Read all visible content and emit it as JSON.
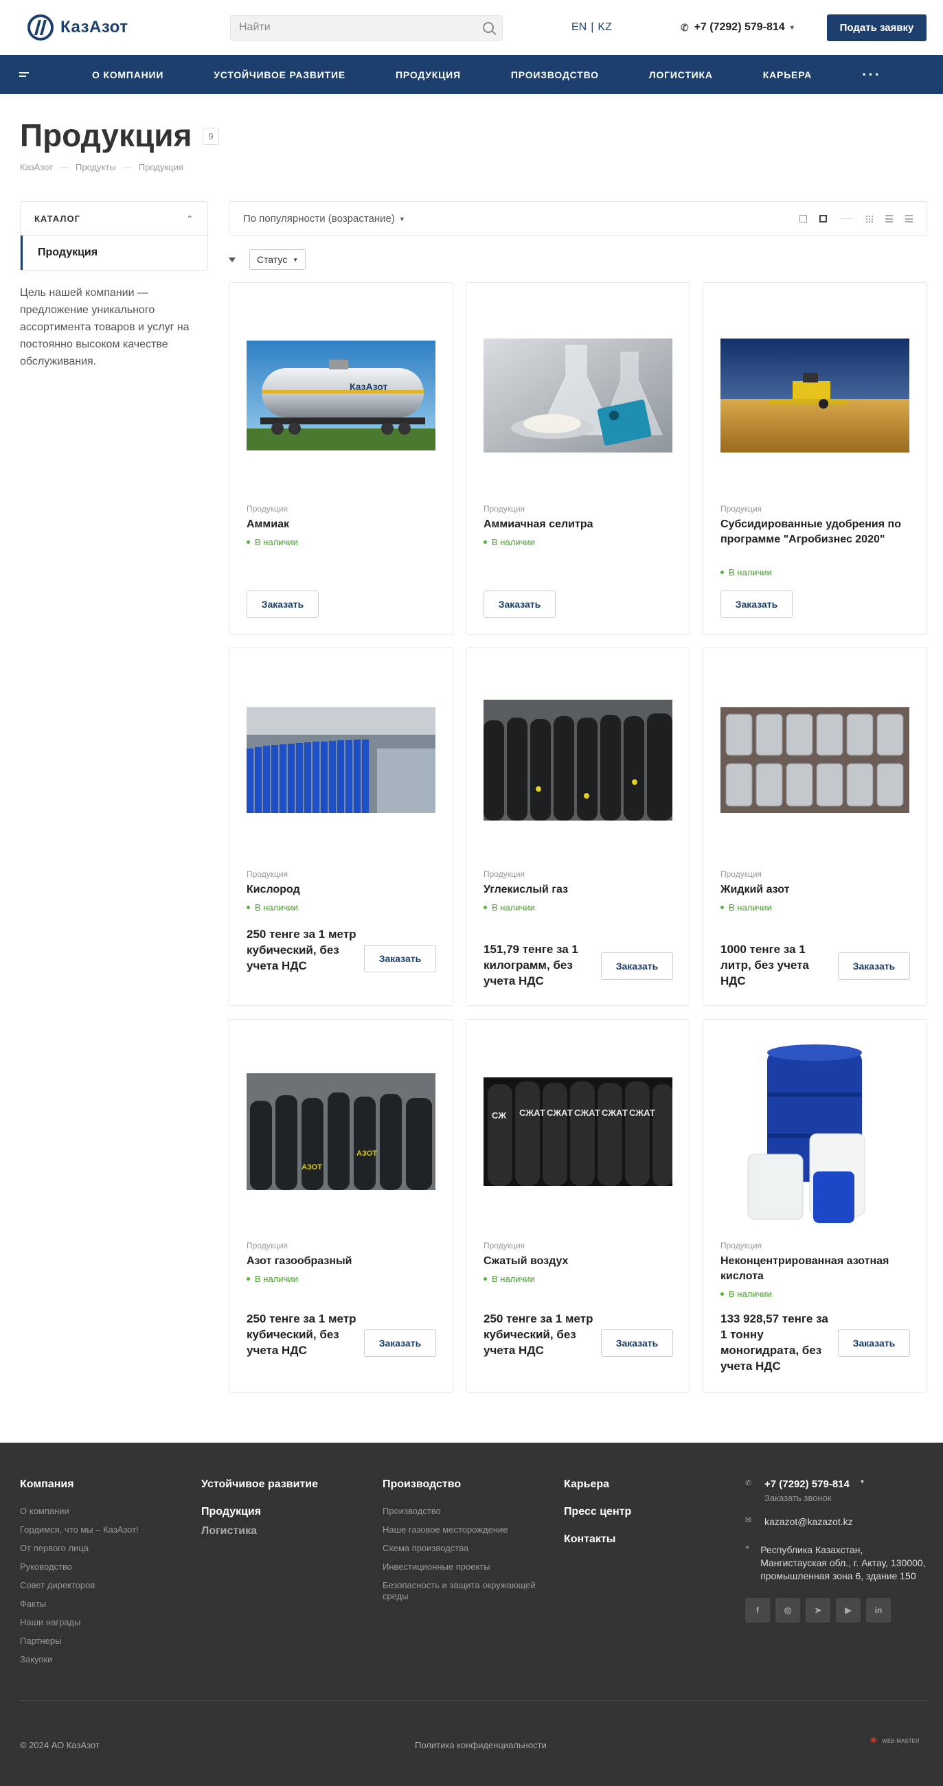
{
  "header": {
    "logo_text": "КазАзот",
    "search_placeholder": "Найти",
    "lang_en": "EN",
    "lang_sep": "|",
    "lang_kz": "KZ",
    "phone": "+7 (7292) 579-814",
    "apply_button": "Подать заявку"
  },
  "nav": {
    "items": [
      "О компании",
      "Устойчивое развитие",
      "Продукция",
      "Производство",
      "Логистика",
      "Карьера"
    ],
    "more": "···"
  },
  "page": {
    "title": "Продукция",
    "count": "9",
    "breadcrumb": [
      "КазАзот",
      "Продукты",
      "Продукция"
    ]
  },
  "sidebar": {
    "catalog_label": "КАТАЛОГ",
    "active_item": "Продукция",
    "description": "Цель нашей компании — предложение уникального ассортимента товаров и услуг на постоянно высоком качестве обслуживания."
  },
  "toolbar": {
    "sort_label": "По популярности (возрастание)",
    "status_filter": "Статус"
  },
  "products": [
    {
      "category": "Продукция",
      "name": "Аммиак",
      "stock": "В наличии",
      "price": "",
      "button": "Заказать",
      "image": "tank-wagon"
    },
    {
      "category": "Продукция",
      "name": "Аммиачная селитра",
      "stock": "В наличии",
      "price": "",
      "button": "Заказать",
      "image": "lab-flasks"
    },
    {
      "category": "Продукция",
      "name": "Субсидированные удобрения по программе \"Агробизнес 2020\"",
      "stock": "В наличии",
      "price": "",
      "button": "Заказать",
      "image": "harvester-field"
    },
    {
      "category": "Продукция",
      "name": "Кислород",
      "stock": "В наличии",
      "price": "250 тенге за 1 метр кубический, без учета НДС",
      "button": "Заказать",
      "image": "blue-cylinders"
    },
    {
      "category": "Продукция",
      "name": "Углекислый газ",
      "stock": "В наличии",
      "price": "151,79 тенге за 1 килограмм, без учета НДС",
      "button": "Заказать",
      "image": "black-cylinders"
    },
    {
      "category": "Продукция",
      "name": "Жидкий азот",
      "stock": "В наличии",
      "price": "1000 тенге за 1 литр, без учета НДС",
      "button": "Заказать",
      "image": "dewar-flasks"
    },
    {
      "category": "Продукция",
      "name": "Азот газообразный",
      "stock": "В наличии",
      "price": "250 тенге за 1 метр кубический, без учета НДС",
      "button": "Заказать",
      "image": "nitrogen-cylinders"
    },
    {
      "category": "Продукция",
      "name": "Сжатый воздух",
      "stock": "В наличии",
      "price": "250 тенге за 1 метр кубический, без учета НДС",
      "button": "Заказать",
      "image": "air-cylinders"
    },
    {
      "category": "Продукция",
      "name": "Неконцентрированная азотная кислота",
      "stock": "В наличии",
      "price": "133 928,57 тенге за 1 тонну моногидрата, без учета НДС",
      "button": "Заказать",
      "image": "acid-containers"
    }
  ],
  "footer": {
    "col1": {
      "title": "Компания",
      "links": [
        "О компании",
        "Гордимся, что мы – КазАзот!",
        "От первого лица",
        "Руководство",
        "Совет директоров",
        "Факты",
        "Наши награды",
        "Партнеры",
        "Закупки"
      ]
    },
    "col2": {
      "title": "Устойчивое развитие",
      "sub1": "Продукция",
      "sub2": "Логистика"
    },
    "col3": {
      "title": "Производство",
      "links": [
        "Производство",
        "Наше газовое месторождение",
        "Схема производства",
        "Инвестиционные проекты",
        "Безопасность и защита окружающей среды"
      ]
    },
    "col4": {
      "items": [
        "Карьера",
        "Пресс центр",
        "Контакты"
      ]
    },
    "contact": {
      "phone": "+7 (7292) 579-814",
      "callback": "Заказать звонок",
      "email": "kazazot@kazazot.kz",
      "address": "Республика Казахстан, Мангистауская обл., г. Актау, 130000, промышленная зона 6, здание 150"
    },
    "socials": [
      "facebook-icon",
      "instagram-icon",
      "telegram-icon",
      "youtube-icon",
      "linkedin-icon"
    ],
    "copyright": "© 2024 АО КазАзот",
    "privacy": "Политика конфиденциальности",
    "developer": "WEB-MASTER"
  },
  "colors": {
    "brand": "#1d3f6e",
    "stock_green": "#55b33a",
    "footer_bg": "#333333"
  }
}
